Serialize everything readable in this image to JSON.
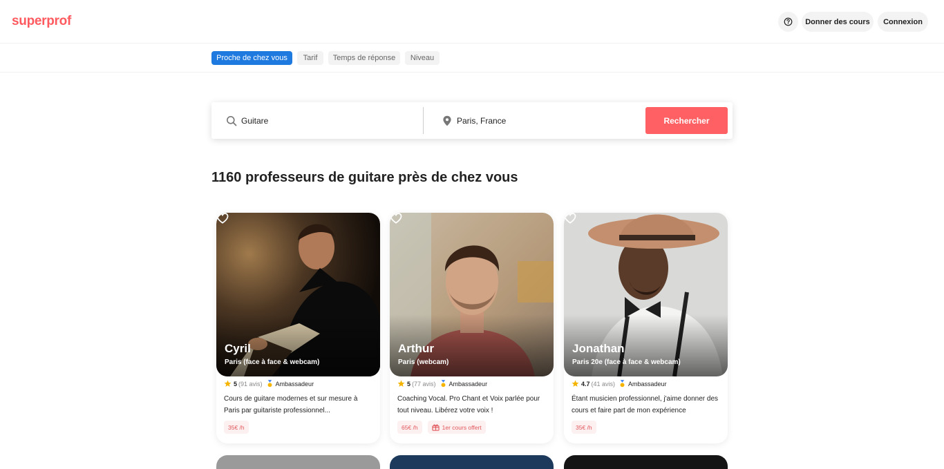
{
  "header": {
    "logo": "superprof",
    "help_icon": "question-circle-icon",
    "teach_label": "Donner des cours",
    "login_label": "Connexion"
  },
  "filters": [
    {
      "label": "Proche de chez vous",
      "active": true
    },
    {
      "label": "Tarif",
      "active": false
    },
    {
      "label": "Temps de réponse",
      "active": false
    },
    {
      "label": "Niveau",
      "active": false
    }
  ],
  "search": {
    "subject_value": "Guitare",
    "location_value": "Paris, France",
    "submit_label": "Rechercher",
    "subject_icon": "search-icon",
    "location_icon": "location-pin-icon"
  },
  "results": {
    "title": "1160 professeurs de guitare près de chez vous"
  },
  "colors": {
    "brand": "#ff5a5f",
    "active_filter": "#1f7ae0",
    "star": "#f5b400"
  },
  "tutors": [
    {
      "name": "Cyril",
      "location": "Paris (face à face & webcam)",
      "rating": "5",
      "reviews": "(91 avis)",
      "badge": "Ambassadeur",
      "description": "Cours de guitare modernes et sur mesure à Paris par guitariste professionnel...",
      "price": "35€ /h",
      "offer": ""
    },
    {
      "name": "Arthur",
      "location": "Paris (webcam)",
      "rating": "5",
      "reviews": "(77 avis)",
      "badge": "Ambassadeur",
      "description": "Coaching Vocal. Pro Chant et Voix parlée pour tout niveau. Libérez votre voix !",
      "price": "65€ /h",
      "offer": "1er cours offert"
    },
    {
      "name": "Jonathan",
      "location": "Paris 20e (face à face & webcam)",
      "rating": "4.7",
      "reviews": "(41 avis)",
      "badge": "Ambassadeur",
      "description": "Étant musicien professionnel, j'aime donner des cours et faire part de mon expérience",
      "price": "35€ /h",
      "offer": ""
    }
  ]
}
